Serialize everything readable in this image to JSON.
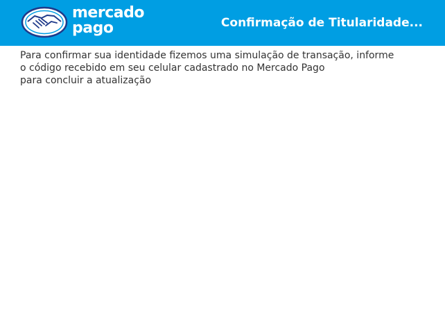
{
  "header": {
    "brand_line1": "mercado",
    "brand_line2": "pago",
    "title": "Confirmação de Titularidade...",
    "background": "#009ee3",
    "logo_icon": "handshake-icon"
  },
  "main": {
    "message_lines": [
      "Para confirmar sua identidade fizemos uma simulação de transação, informe",
      "o código recebido em seu celular cadastrado no Mercado Pago",
      "para concluir a atualização"
    ]
  }
}
